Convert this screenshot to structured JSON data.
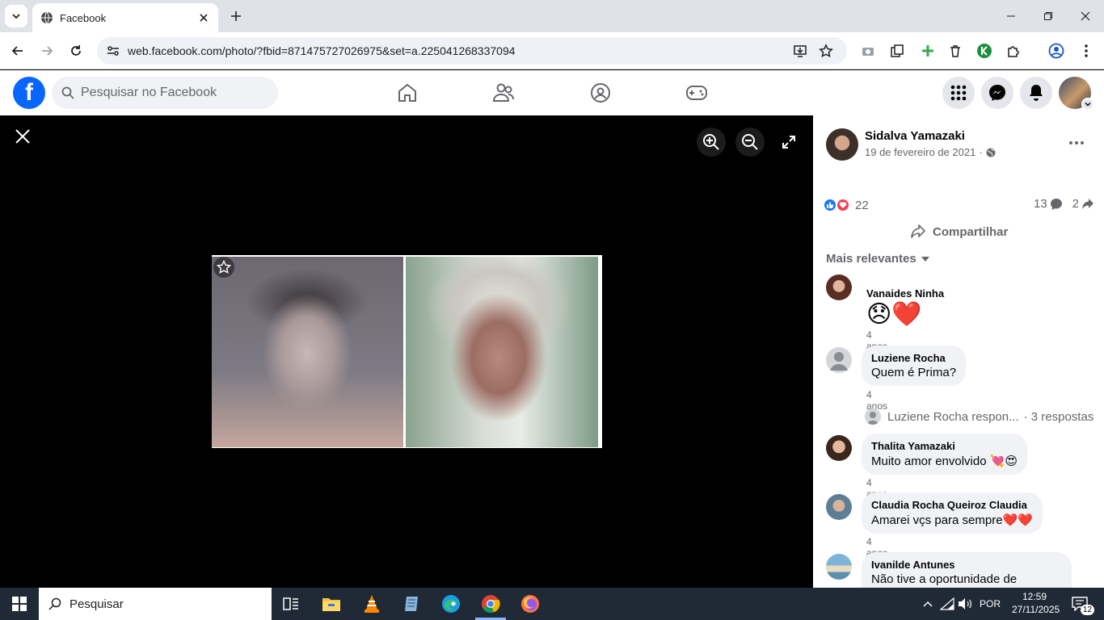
{
  "browser": {
    "tab_title": "Facebook",
    "url": "web.facebook.com/photo/?fbid=871475727026975&set=a.225041268337094"
  },
  "header": {
    "logo": "f",
    "search_placeholder": "Pesquisar no Facebook"
  },
  "post": {
    "author": "Sidalva Yamazaki",
    "date": "19 de fevereiro de 2021",
    "date_separator": "·",
    "reactions_count": "22",
    "comments_count": "13",
    "shares_count": "2",
    "share_label": "Compartilhar",
    "sort_label": "Mais relevantes"
  },
  "comments": [
    {
      "name": "Vanaides Ninha",
      "text": "😞❤️",
      "time": "4 anos"
    },
    {
      "name": "Luziene Rocha",
      "text": "Quem é Prima?",
      "time": "4 anos"
    },
    {
      "name": "Thalita Yamazaki",
      "text": "Muito amor envolvido 💘😍",
      "time": "4 anos"
    },
    {
      "name": "Claudia Rocha Queiroz Claudia",
      "text": "Amarei vçs para sempre❤️❤️",
      "time": "4 anos"
    },
    {
      "name": "Ivanilde Antunes",
      "text": "Não tive a oportunidade de"
    }
  ],
  "replies": {
    "name": "Luziene Rocha respon...",
    "count": "· 3 respostas"
  },
  "taskbar": {
    "search_label": "Pesquisar",
    "language": "POR",
    "time": "12:59",
    "date": "27/11/2025",
    "notifications": "12"
  },
  "colors": {
    "fb_blue": "#0866ff",
    "like_blue": "#1877f2",
    "love_red": "#f33e58"
  }
}
